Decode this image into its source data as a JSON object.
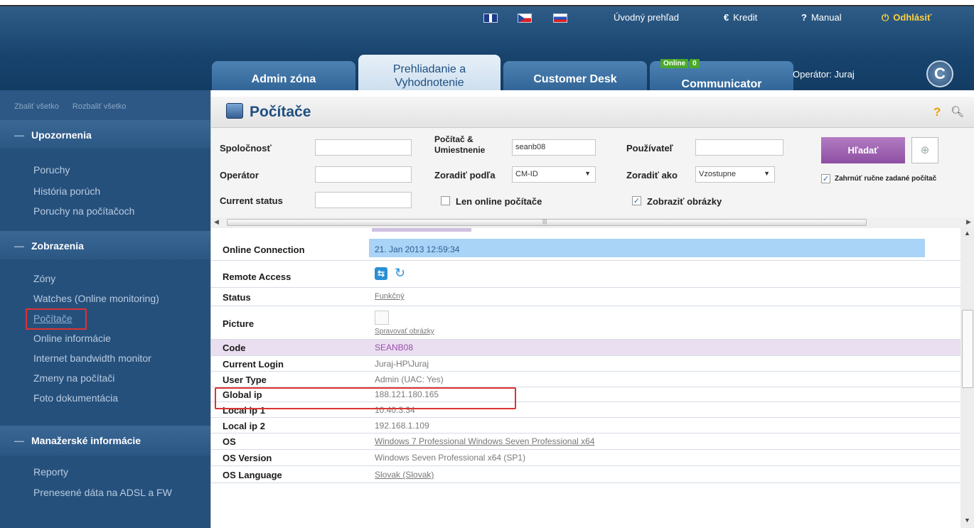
{
  "header": {
    "flags": [
      "English flag",
      "Czech flag",
      "Slovak flag"
    ],
    "links": [
      {
        "label": "Úvodný prehľad",
        "icon": ""
      },
      {
        "label": "Kredit",
        "icon": "€"
      },
      {
        "label": "Manual",
        "icon": "?"
      },
      {
        "label": "Odhlásiť",
        "icon": "⏻"
      }
    ],
    "tabs": [
      {
        "label": "Admin zóna"
      },
      {
        "label": "Prehliadanie a Vyhodnotenie"
      },
      {
        "label": "Customer Desk"
      },
      {
        "label": "Communicator"
      }
    ],
    "online_badge": {
      "label": "Online",
      "count": "0"
    },
    "operator": "Operátor: Juraj",
    "logo_letter": "C"
  },
  "sidebar": {
    "collapse_all": "Zbaliť všetko",
    "expand_all": "Rozbaliť všetko",
    "sections": [
      {
        "title": "Upozornenia",
        "items": [
          "Poruchy",
          "História porúch",
          "Poruchy na počítačoch"
        ]
      },
      {
        "title": "Zobrazenia",
        "items": [
          "Zóny",
          "Watches (Online monitoring)",
          "Počítače",
          "Online informácie",
          "Internet bandwidth monitor",
          "Zmeny na počítači",
          "Foto dokumentácia"
        ]
      },
      {
        "title": "Manažerské informácie",
        "items": [
          "Reporty",
          "Prenesené dáta na ADSL a FW"
        ]
      }
    ]
  },
  "page": {
    "title": "Počítače",
    "help": "?"
  },
  "filters": {
    "company_label": "Spoločnosť",
    "company_value": "",
    "pc_label_1": "Počítač &",
    "pc_label_2": "Umiestnenie",
    "pc_value": "seanb08",
    "user_label": "Používateľ",
    "user_value": "",
    "operator_label": "Operátor",
    "operator_value": "",
    "sort_by_label": "Zoradiť podľa",
    "sort_by_value": "CM-ID",
    "sort_as_label": "Zoradiť ako",
    "sort_as_value": "Vzostupne",
    "status_label": "Current status",
    "status_value": "",
    "online_only_label": "Len online počítače",
    "online_only_checked": false,
    "show_images_label": "Zobraziť obrázky",
    "show_images_checked": true,
    "include_manual_label": "Zahrnúť ručne zadané počítač",
    "include_manual_checked": true,
    "search_button": "Hľadať"
  },
  "details": [
    {
      "key": "Online Connection",
      "value": "21. Jan 2013 12:59:34"
    },
    {
      "key": "Remote Access",
      "value": ""
    },
    {
      "key": "Status",
      "value": "Funkčný"
    },
    {
      "key": "Picture",
      "value": "Spravovať obrázky"
    },
    {
      "key": "Code",
      "value": "SEANB08"
    },
    {
      "key": "Current Login",
      "value": "Juraj-HP\\Juraj"
    },
    {
      "key": "User Type",
      "value": "Admin (UAC: Yes)"
    },
    {
      "key": "Global ip",
      "value": "188.121.180.165"
    },
    {
      "key": "Local ip 1",
      "value": "10.40.3.34"
    },
    {
      "key": "Local ip 2",
      "value": "192.168.1.109"
    },
    {
      "key": "OS",
      "value": "Windows 7 Professional Windows Seven Professional x64"
    },
    {
      "key": "OS Version",
      "value": "Windows Seven Professional x64 (SP1)"
    },
    {
      "key": "OS Language",
      "value": "Slovak (Slovak)"
    }
  ],
  "colors": {
    "highlight": "#d33333",
    "online_row": "#a9d3f7",
    "code_row": "#eadff0",
    "accent": "#1f4f80"
  }
}
